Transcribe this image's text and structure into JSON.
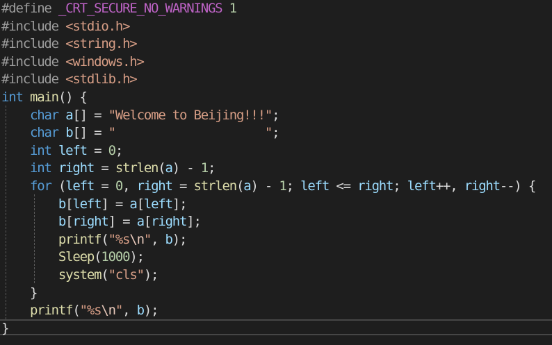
{
  "editor": {
    "language": "C",
    "lines": [
      {
        "tokens": [
          {
            "c": "pp",
            "t": "#define "
          },
          {
            "c": "mac",
            "t": "_CRT_SECURE_NO_WARNINGS"
          },
          {
            "c": "pl",
            "t": " "
          },
          {
            "c": "num",
            "t": "1"
          }
        ]
      },
      {
        "tokens": [
          {
            "c": "pp",
            "t": "#include "
          },
          {
            "c": "str",
            "t": "<stdio.h>"
          }
        ]
      },
      {
        "tokens": [
          {
            "c": "pp",
            "t": "#include "
          },
          {
            "c": "str",
            "t": "<string.h>"
          }
        ]
      },
      {
        "tokens": [
          {
            "c": "pp",
            "t": "#include "
          },
          {
            "c": "str",
            "t": "<windows.h>"
          }
        ]
      },
      {
        "tokens": [
          {
            "c": "pp",
            "t": "#include "
          },
          {
            "c": "str",
            "t": "<stdlib.h>"
          }
        ]
      },
      {
        "tokens": [
          {
            "c": "kw",
            "t": "int"
          },
          {
            "c": "pl",
            "t": " "
          },
          {
            "c": "fn",
            "t": "main"
          },
          {
            "c": "pl",
            "t": "() {"
          }
        ]
      },
      {
        "tokens": [
          {
            "c": "pl",
            "t": "    "
          },
          {
            "c": "kw",
            "t": "char"
          },
          {
            "c": "pl",
            "t": " "
          },
          {
            "c": "var",
            "t": "a"
          },
          {
            "c": "pl",
            "t": "[] = "
          },
          {
            "c": "str",
            "t": "\"Welcome to Beijing!!!\""
          },
          {
            "c": "pl",
            "t": ";"
          }
        ]
      },
      {
        "tokens": [
          {
            "c": "pl",
            "t": "    "
          },
          {
            "c": "kw",
            "t": "char"
          },
          {
            "c": "pl",
            "t": " "
          },
          {
            "c": "var",
            "t": "b"
          },
          {
            "c": "pl",
            "t": "[] = "
          },
          {
            "c": "str",
            "t": "\"                     \""
          },
          {
            "c": "pl",
            "t": ";"
          }
        ]
      },
      {
        "tokens": [
          {
            "c": "pl",
            "t": "    "
          },
          {
            "c": "kw",
            "t": "int"
          },
          {
            "c": "pl",
            "t": " "
          },
          {
            "c": "var",
            "t": "left"
          },
          {
            "c": "pl",
            "t": " = "
          },
          {
            "c": "num",
            "t": "0"
          },
          {
            "c": "pl",
            "t": ";"
          }
        ]
      },
      {
        "tokens": [
          {
            "c": "pl",
            "t": "    "
          },
          {
            "c": "kw",
            "t": "int"
          },
          {
            "c": "pl",
            "t": " "
          },
          {
            "c": "var",
            "t": "right"
          },
          {
            "c": "pl",
            "t": " = "
          },
          {
            "c": "fn",
            "t": "strlen"
          },
          {
            "c": "pl",
            "t": "("
          },
          {
            "c": "var",
            "t": "a"
          },
          {
            "c": "pl",
            "t": ") - "
          },
          {
            "c": "num",
            "t": "1"
          },
          {
            "c": "pl",
            "t": ";"
          }
        ]
      },
      {
        "tokens": [
          {
            "c": "pl",
            "t": "    "
          },
          {
            "c": "kw",
            "t": "for"
          },
          {
            "c": "pl",
            "t": " ("
          },
          {
            "c": "var",
            "t": "left"
          },
          {
            "c": "pl",
            "t": " = "
          },
          {
            "c": "num",
            "t": "0"
          },
          {
            "c": "pl",
            "t": ", "
          },
          {
            "c": "var",
            "t": "right"
          },
          {
            "c": "pl",
            "t": " = "
          },
          {
            "c": "fn",
            "t": "strlen"
          },
          {
            "c": "pl",
            "t": "("
          },
          {
            "c": "var",
            "t": "a"
          },
          {
            "c": "pl",
            "t": ") - "
          },
          {
            "c": "num",
            "t": "1"
          },
          {
            "c": "pl",
            "t": "; "
          },
          {
            "c": "var",
            "t": "left"
          },
          {
            "c": "pl",
            "t": " <= "
          },
          {
            "c": "var",
            "t": "right"
          },
          {
            "c": "pl",
            "t": "; "
          },
          {
            "c": "var",
            "t": "left"
          },
          {
            "c": "pl",
            "t": "++, "
          },
          {
            "c": "var",
            "t": "right"
          },
          {
            "c": "pl",
            "t": "--) {"
          }
        ]
      },
      {
        "tokens": [
          {
            "c": "pl",
            "t": "        "
          },
          {
            "c": "var",
            "t": "b"
          },
          {
            "c": "pl",
            "t": "["
          },
          {
            "c": "var",
            "t": "left"
          },
          {
            "c": "pl",
            "t": "] = "
          },
          {
            "c": "var",
            "t": "a"
          },
          {
            "c": "pl",
            "t": "["
          },
          {
            "c": "var",
            "t": "left"
          },
          {
            "c": "pl",
            "t": "];"
          }
        ]
      },
      {
        "tokens": [
          {
            "c": "pl",
            "t": "        "
          },
          {
            "c": "var",
            "t": "b"
          },
          {
            "c": "pl",
            "t": "["
          },
          {
            "c": "var",
            "t": "right"
          },
          {
            "c": "pl",
            "t": "] = "
          },
          {
            "c": "var",
            "t": "a"
          },
          {
            "c": "pl",
            "t": "["
          },
          {
            "c": "var",
            "t": "right"
          },
          {
            "c": "pl",
            "t": "];"
          }
        ]
      },
      {
        "tokens": [
          {
            "c": "pl",
            "t": "        "
          },
          {
            "c": "fn",
            "t": "printf"
          },
          {
            "c": "pl",
            "t": "("
          },
          {
            "c": "str",
            "t": "\"%s"
          },
          {
            "c": "esc",
            "t": "\\n"
          },
          {
            "c": "str",
            "t": "\""
          },
          {
            "c": "pl",
            "t": ", "
          },
          {
            "c": "var",
            "t": "b"
          },
          {
            "c": "pl",
            "t": ");"
          }
        ]
      },
      {
        "tokens": [
          {
            "c": "pl",
            "t": "        "
          },
          {
            "c": "fn",
            "t": "Sleep"
          },
          {
            "c": "pl",
            "t": "("
          },
          {
            "c": "num",
            "t": "1000"
          },
          {
            "c": "pl",
            "t": ");"
          }
        ]
      },
      {
        "tokens": [
          {
            "c": "pl",
            "t": "        "
          },
          {
            "c": "fn",
            "t": "system"
          },
          {
            "c": "pl",
            "t": "("
          },
          {
            "c": "str",
            "t": "\"cls\""
          },
          {
            "c": "pl",
            "t": ");"
          }
        ]
      },
      {
        "tokens": [
          {
            "c": "pl",
            "t": "    }"
          }
        ]
      },
      {
        "tokens": [
          {
            "c": "pl",
            "t": "    "
          },
          {
            "c": "fn",
            "t": "printf"
          },
          {
            "c": "pl",
            "t": "("
          },
          {
            "c": "str",
            "t": "\"%s"
          },
          {
            "c": "esc",
            "t": "\\n"
          },
          {
            "c": "str",
            "t": "\""
          },
          {
            "c": "pl",
            "t": ", "
          },
          {
            "c": "var",
            "t": "b"
          },
          {
            "c": "pl",
            "t": ");"
          }
        ]
      },
      {
        "tokens": [
          {
            "c": "pl",
            "t": "}"
          }
        ]
      }
    ]
  },
  "colors": {
    "background": "#1e1e1e",
    "keyword": "#569cd6",
    "preprocessor": "#9b9b9b",
    "string": "#d69d85",
    "number": "#b5cea8",
    "function": "#dcdcaa",
    "variable": "#9cdcfe",
    "macro": "#bd63c5",
    "plain": "#dcdcdc"
  }
}
